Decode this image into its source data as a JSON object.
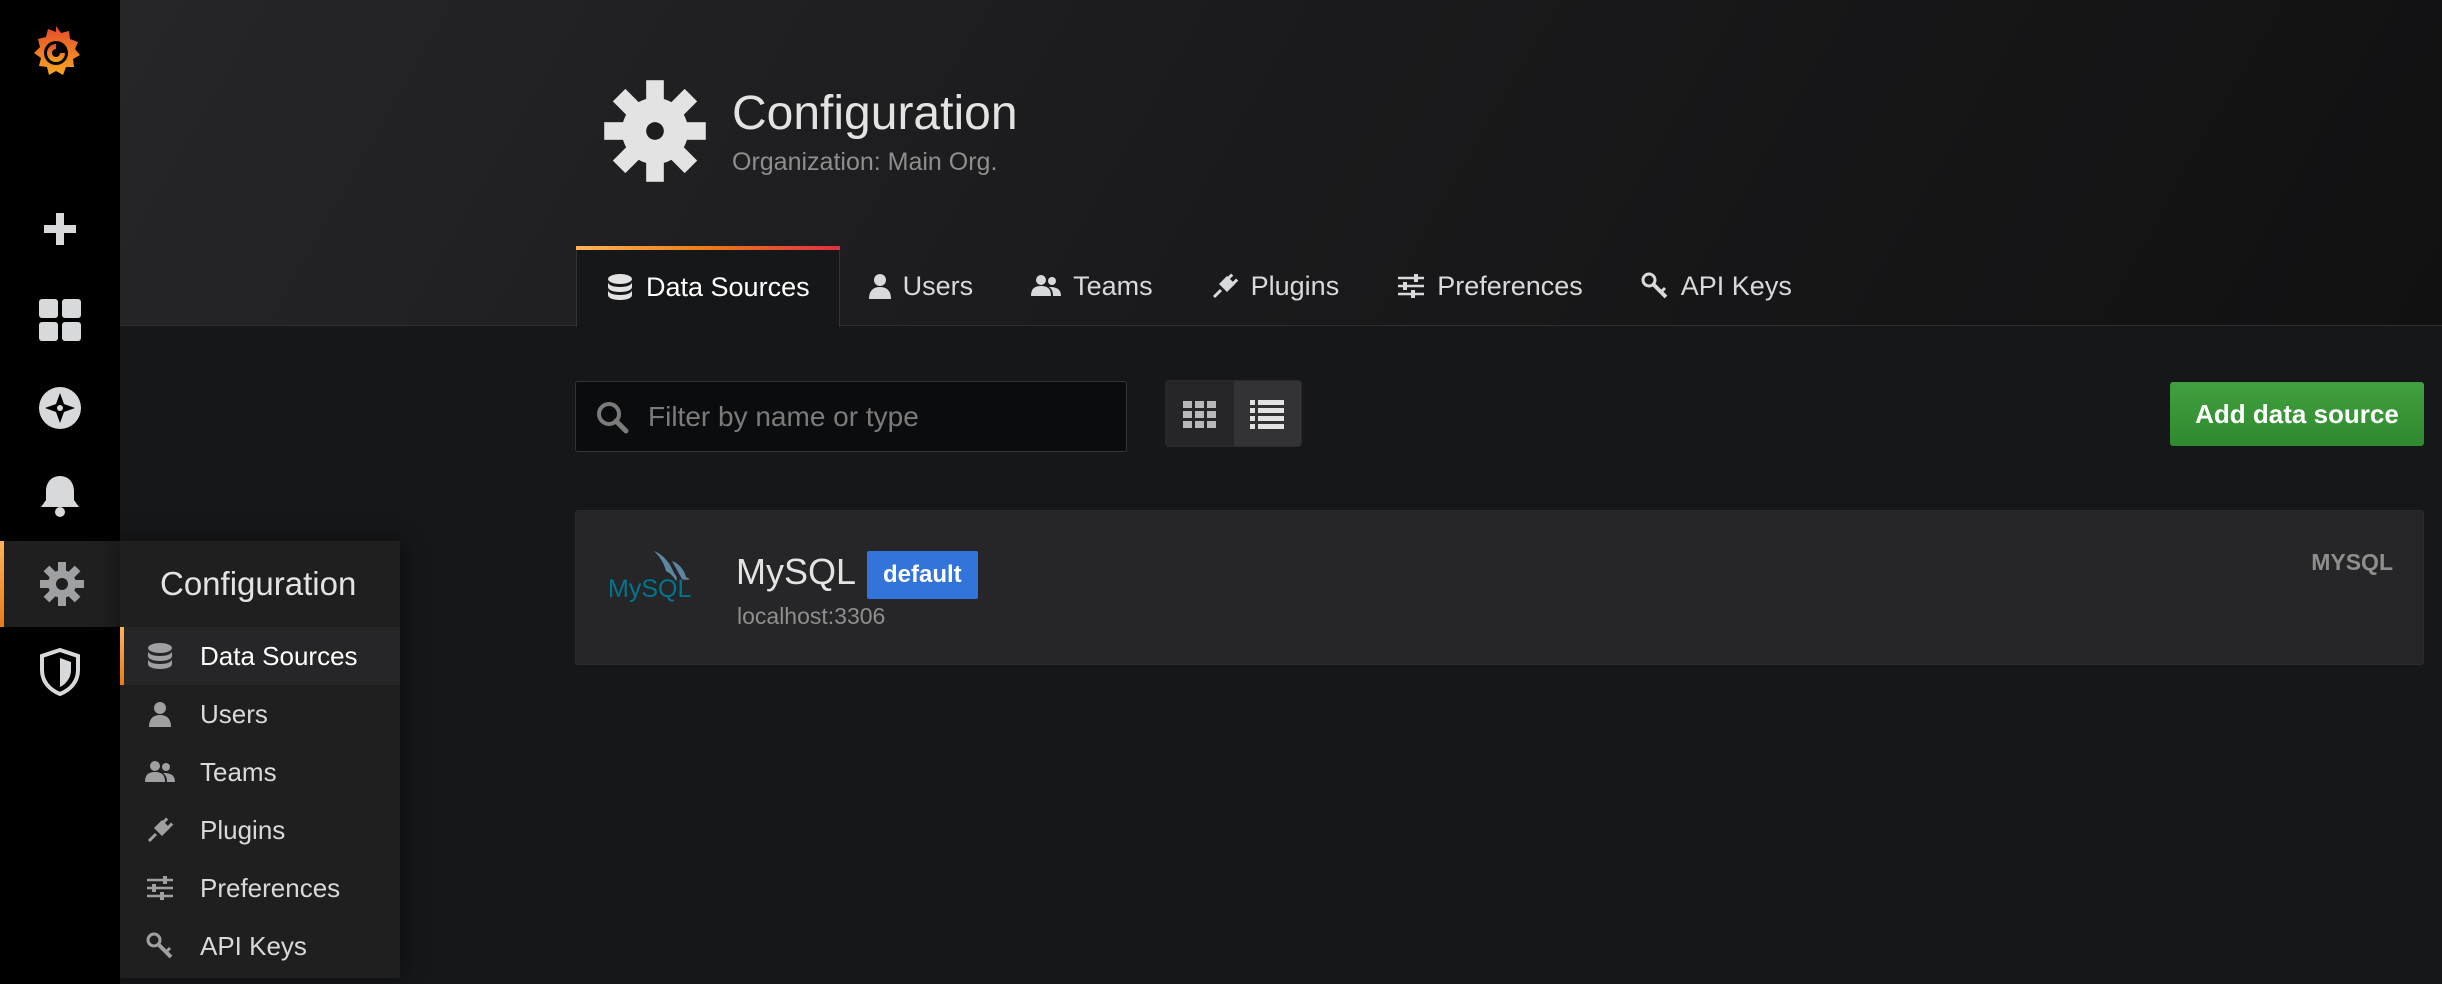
{
  "header": {
    "title": "Configuration",
    "subtitle": "Organization: Main Org.",
    "icon": "gear-icon"
  },
  "tabs": [
    {
      "label": "Data Sources",
      "icon": "database-icon",
      "active": true
    },
    {
      "label": "Users",
      "icon": "user-icon",
      "active": false
    },
    {
      "label": "Teams",
      "icon": "users-icon",
      "active": false
    },
    {
      "label": "Plugins",
      "icon": "plug-icon",
      "active": false
    },
    {
      "label": "Preferences",
      "icon": "sliders-icon",
      "active": false
    },
    {
      "label": "API Keys",
      "icon": "key-icon",
      "active": false
    }
  ],
  "sidemenu": {
    "items": [
      {
        "icon": "plus-icon"
      },
      {
        "icon": "dashboards-icon"
      },
      {
        "icon": "compass-icon"
      },
      {
        "icon": "bell-icon"
      },
      {
        "icon": "gear-icon",
        "active": true
      },
      {
        "icon": "shield-icon"
      }
    ]
  },
  "dropdown": {
    "header": "Configuration",
    "items": [
      {
        "label": "Data Sources",
        "icon": "database-icon",
        "active": true
      },
      {
        "label": "Users",
        "icon": "user-icon"
      },
      {
        "label": "Teams",
        "icon": "users-icon"
      },
      {
        "label": "Plugins",
        "icon": "plug-icon"
      },
      {
        "label": "Preferences",
        "icon": "sliders-icon"
      },
      {
        "label": "API Keys",
        "icon": "key-icon"
      }
    ]
  },
  "search": {
    "placeholder": "Filter by name or type",
    "value": ""
  },
  "layout": {
    "selected": "list"
  },
  "actions": {
    "add_label": "Add data source"
  },
  "datasources": [
    {
      "name": "MySQL",
      "badge": "default",
      "url": "localhost:3306",
      "type": "MYSQL",
      "logo_text": "MySQL"
    }
  ],
  "colors": {
    "accent": "#eb7b18",
    "primary_button": "#3d9a3d",
    "badge": "#3274d9",
    "background": "#161719"
  }
}
